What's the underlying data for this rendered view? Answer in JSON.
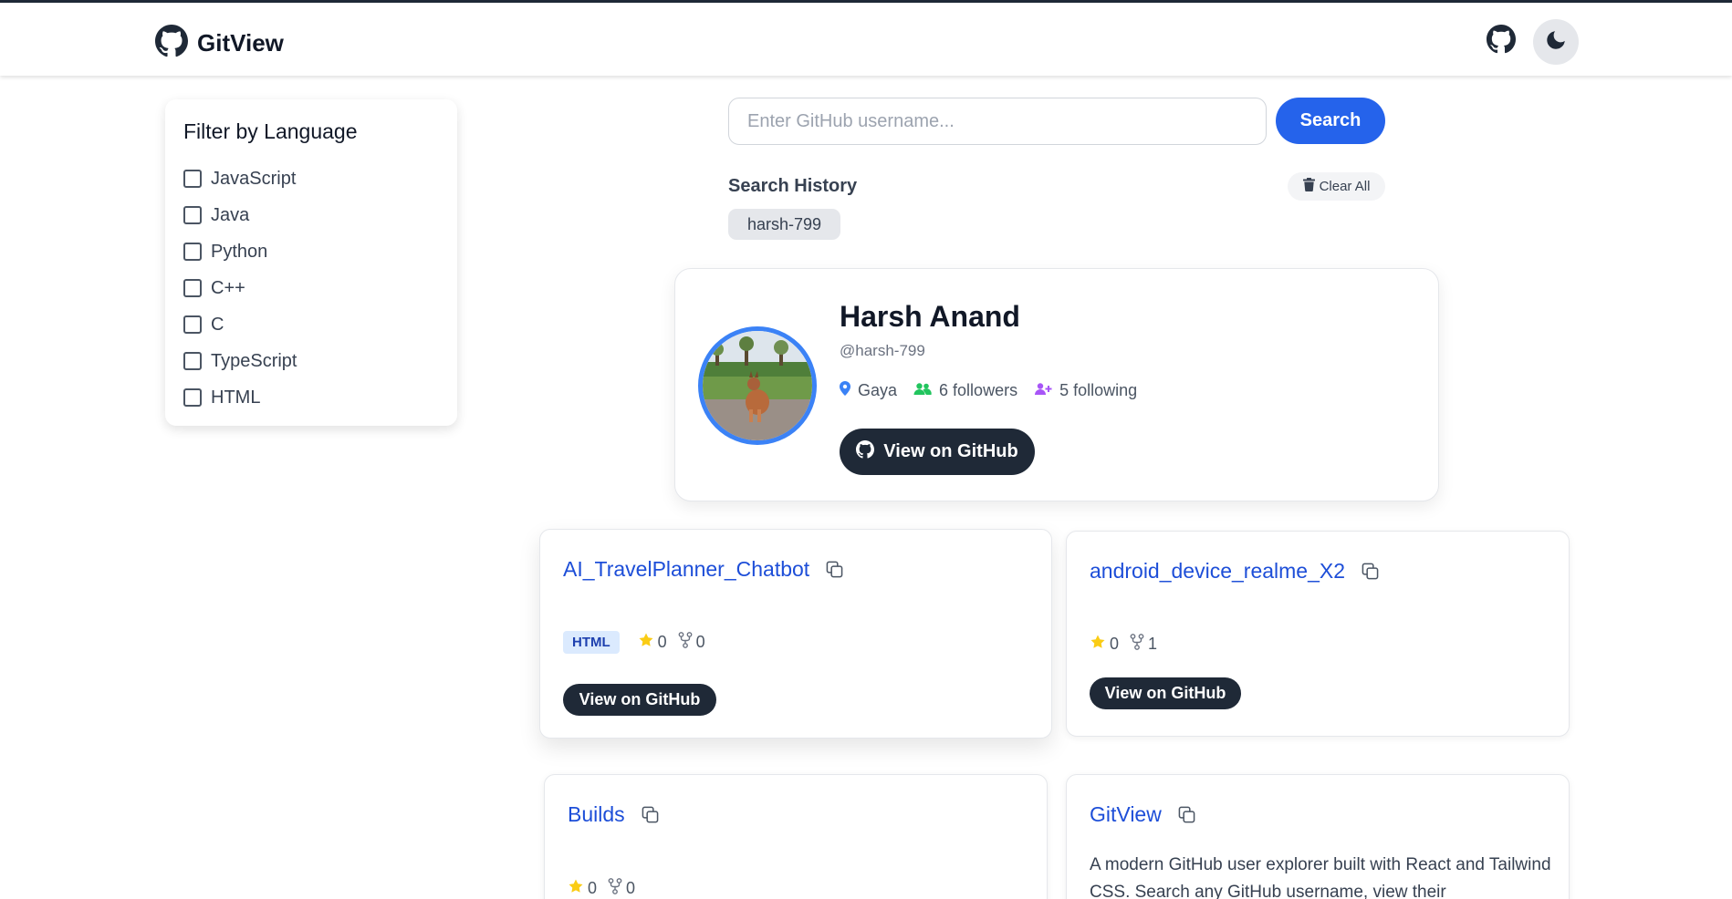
{
  "app": {
    "title": "GitView"
  },
  "theme": {
    "primary": "#2563eb",
    "dark": "#1f2937",
    "link": "#1d4ed8",
    "avatar_ring": "#3b82f6"
  },
  "filter": {
    "title": "Filter by Language",
    "languages": [
      "JavaScript",
      "Java",
      "Python",
      "C++",
      "C",
      "TypeScript",
      "HTML"
    ]
  },
  "search": {
    "placeholder": "Enter GitHub username...",
    "value": "",
    "button_label": "Search"
  },
  "history": {
    "title": "Search History",
    "clear_label": "Clear All",
    "items": [
      "harsh-799"
    ]
  },
  "profile": {
    "name": "Harsh Anand",
    "handle": "@harsh-799",
    "location": "Gaya",
    "followers": "6 followers",
    "following": "5 following",
    "button_label": "View on GitHub"
  },
  "repos": [
    {
      "name": "AI_TravelPlanner_Chatbot",
      "language": "HTML",
      "stars": "0",
      "forks": "0",
      "button_label": "View on GitHub"
    },
    {
      "name": "android_device_realme_X2",
      "stars": "0",
      "forks": "1",
      "button_label": "View on GitHub"
    },
    {
      "name": "Builds",
      "stars": "0",
      "forks": "0"
    },
    {
      "name": "GitView",
      "description": "A modern GitHub user explorer built with React and Tailwind CSS. Search any GitHub username, view their"
    }
  ]
}
